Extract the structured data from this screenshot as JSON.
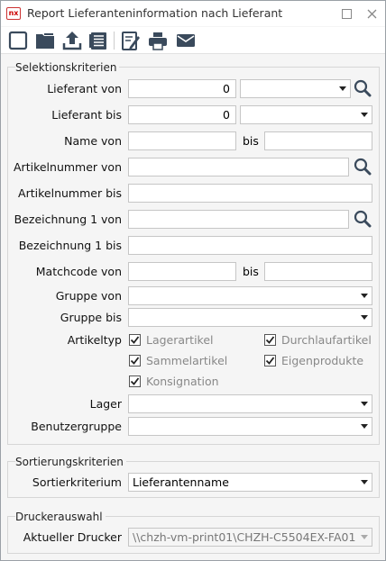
{
  "window": {
    "app_logo_text": "nx",
    "title": "Report Lieferanteninformation nach Lieferant"
  },
  "toolbar": {
    "buttons": [
      {
        "icon": "new-icon"
      },
      {
        "icon": "open-icon"
      },
      {
        "icon": "upload-icon"
      },
      {
        "icon": "list-icon"
      },
      {
        "icon": "edit-icon"
      },
      {
        "icon": "print-icon"
      },
      {
        "icon": "mail-icon"
      }
    ]
  },
  "selection": {
    "title": "Selektionskriterien",
    "lieferant_von": {
      "label": "Lieferant von",
      "value": "0",
      "select": ""
    },
    "lieferant_bis": {
      "label": "Lieferant bis",
      "value": "0",
      "select": ""
    },
    "name_von": {
      "label": "Name von",
      "value": "",
      "bis_label": "bis",
      "bis_value": ""
    },
    "artikelnummer_von": {
      "label": "Artikelnummer von",
      "value": ""
    },
    "artikelnummer_bis": {
      "label": "Artikelnummer bis",
      "value": ""
    },
    "bezeichnung_von": {
      "label": "Bezeichnung 1 von",
      "value": ""
    },
    "bezeichnung_bis": {
      "label": "Bezeichnung 1 bis",
      "value": ""
    },
    "matchcode_von": {
      "label": "Matchcode von",
      "value": "",
      "bis_label": "bis",
      "bis_value": ""
    },
    "gruppe_von": {
      "label": "Gruppe von",
      "value": ""
    },
    "gruppe_bis": {
      "label": "Gruppe bis",
      "value": ""
    },
    "artikeltyp": {
      "label": "Artikeltyp",
      "options": [
        {
          "label": "Lagerartikel",
          "checked": true
        },
        {
          "label": "Durchlaufartikel",
          "checked": true
        },
        {
          "label": "Sammelartikel",
          "checked": true
        },
        {
          "label": "Eigenprodukte",
          "checked": true
        },
        {
          "label": "Konsignation",
          "checked": true
        }
      ]
    },
    "lager": {
      "label": "Lager",
      "value": ""
    },
    "benutzergruppe": {
      "label": "Benutzergruppe",
      "value": ""
    }
  },
  "sorting": {
    "title": "Sortierungskriterien",
    "sortierkriterium": {
      "label": "Sortierkriterium",
      "value": "Lieferantenname"
    }
  },
  "printer": {
    "title": "Druckerauswahl",
    "current": {
      "label": "Aktueller Drucker",
      "value": "\\\\chzh-vm-print01\\CHZH-C5504EX-FA01"
    }
  },
  "colors": {
    "accent": "#1f4e79",
    "icon": "#3a4a5c",
    "window_bg": "#f5f5f5"
  }
}
